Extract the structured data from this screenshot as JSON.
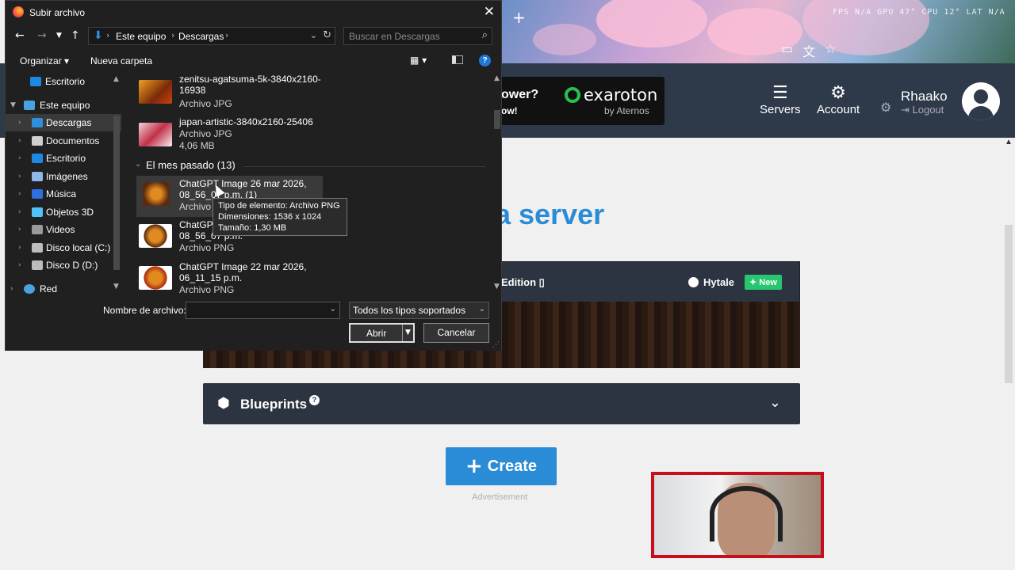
{
  "browser": {
    "perf_overlay": "FPS N/A  GPU 47°  CPU 12°  LAT N/A"
  },
  "site": {
    "ad_text_line1": "ower?",
    "ad_text_line2": "ow!",
    "ad_brand": "exaroton",
    "ad_brand_sub": "by Aternos",
    "nav_servers": "Servers",
    "nav_account": "Account",
    "user_name": "Rhaako",
    "logout_label": "Logout",
    "heading_partial": "a server",
    "edition_label": "Edition",
    "hytale_label": "Hytale",
    "new_badge": "New",
    "blueprints_label": "Blueprints",
    "create_label": "Create",
    "advertisement": "Advertisement"
  },
  "dialog": {
    "title": "Subir archivo",
    "breadcrumb": [
      "Este equipo",
      "Descargas"
    ],
    "search_placeholder": "Buscar en Descargas",
    "toolbar": {
      "organize": "Organizar",
      "new_folder": "Nueva carpeta"
    },
    "nav_tree": [
      {
        "label": "Escritorio",
        "color": "#1e88e5"
      },
      {
        "label": "Este equipo",
        "color": "#4aa3df"
      },
      {
        "label": "Descargas",
        "color": "#2f8ee0"
      },
      {
        "label": "Documentos",
        "color": "#cfcfcf"
      },
      {
        "label": "Escritorio",
        "color": "#1e88e5"
      },
      {
        "label": "Imágenes",
        "color": "#8fb8e8"
      },
      {
        "label": "Música",
        "color": "#2f6fe0"
      },
      {
        "label": "Objetos 3D",
        "color": "#4fc3f7"
      },
      {
        "label": "Videos",
        "color": "#9a9a9a"
      },
      {
        "label": "Disco local (C:)",
        "color": "#bdbdbd"
      },
      {
        "label": "Disco D (D:)",
        "color": "#bdbdbd"
      },
      {
        "label": "Red",
        "color": "#4aa3df"
      }
    ],
    "files_top": [
      {
        "name": "zenitsu-agatsuma-5k-3840x2160-16938",
        "kind": "Archivo JPG",
        "size": ""
      },
      {
        "name": "japan-artistic-3840x2160-25406",
        "kind": "Archivo JPG",
        "size": "4,06 MB"
      }
    ],
    "group_header": "El mes pasado (13)",
    "files_group": [
      {
        "name": "ChatGPT Image 26 mar 2026, 08_56_07 p.m. (1)",
        "kind": "Archivo PNG"
      },
      {
        "name": "ChatGPT Image 26 mar 2026, 08_56_07 p.m.",
        "kind": "Archivo PNG"
      },
      {
        "name": "ChatGPT Image 22 mar 2026, 06_11_15 p.m.",
        "kind": "Archivo PNG"
      }
    ],
    "tooltip": {
      "type": "Tipo de elemento: Archivo PNG",
      "dims": "Dimensiones: 1536 x 1024",
      "size": "Tamaño: 1,30 MB"
    },
    "filename_label": "Nombre de archivo:",
    "filename_value": "",
    "filetype_value": "Todos los tipos soportados",
    "open_label": "Abrir",
    "cancel_label": "Cancelar"
  }
}
